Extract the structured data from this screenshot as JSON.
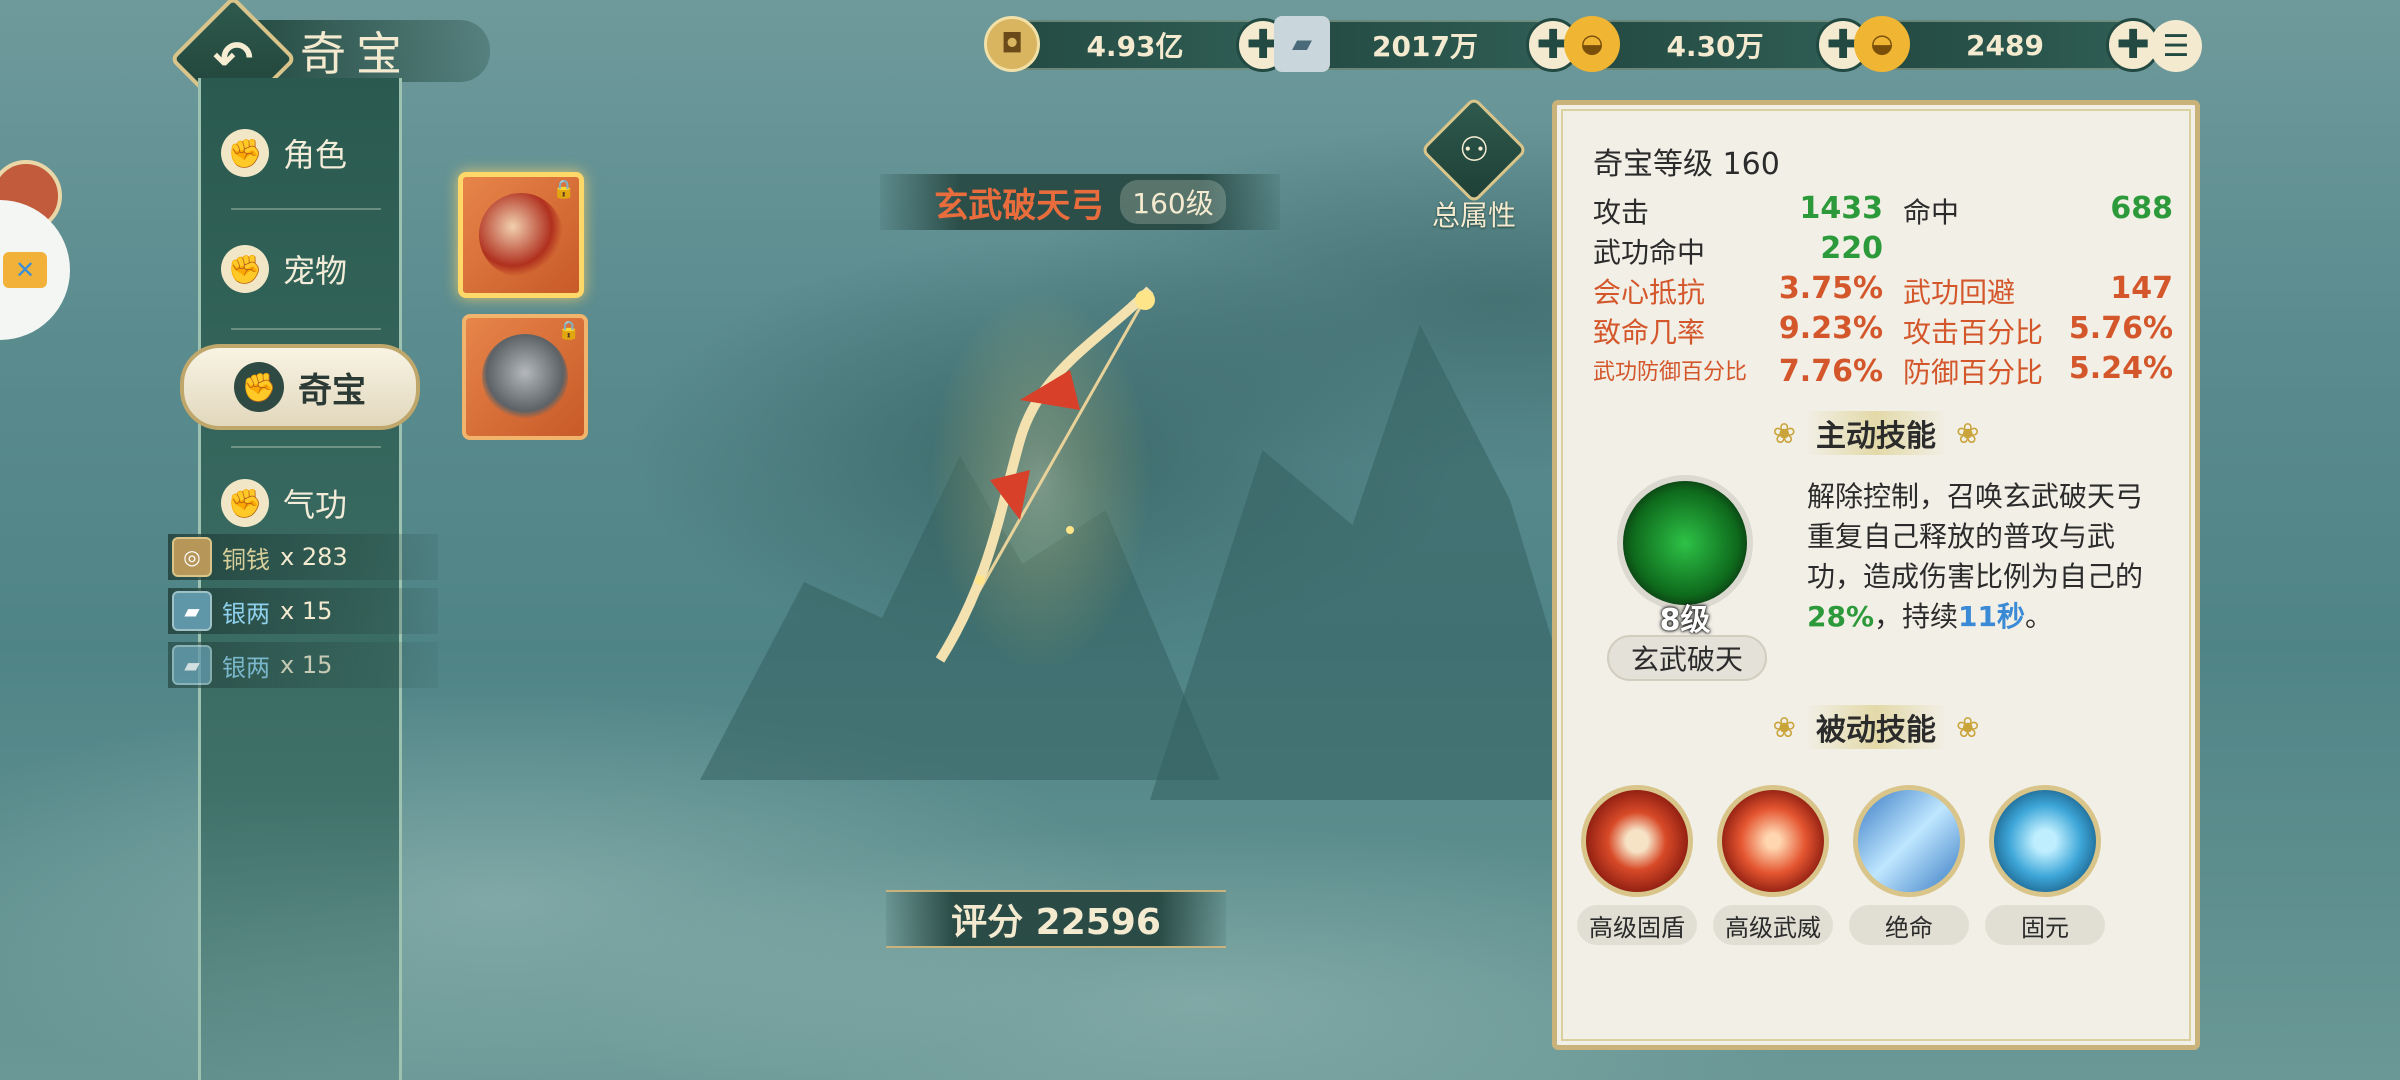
{
  "header": {
    "title": "奇宝",
    "back_icon": "back-arrow-icon"
  },
  "currencies": [
    {
      "name": "copper-coin",
      "value": "4.93亿"
    },
    {
      "name": "silver",
      "value": "2017万"
    },
    {
      "name": "gold-ingot",
      "value": "4.30万"
    },
    {
      "name": "gold-ingot-bound",
      "value": "2489"
    }
  ],
  "sidebar": {
    "items": [
      {
        "label": "角色"
      },
      {
        "label": "宠物"
      },
      {
        "label": "奇宝"
      },
      {
        "label": "气功"
      }
    ],
    "active": "奇宝"
  },
  "loot": [
    {
      "name": "铜钱",
      "count": "x 283"
    },
    {
      "name": "银两",
      "count": "x 15"
    },
    {
      "name": "银两",
      "count": "x 15"
    }
  ],
  "item": {
    "name": "玄武破天弓",
    "level": "160级",
    "score": "评分 22596"
  },
  "total_attr_label": "总属性",
  "panel": {
    "title": "奇宝等级 160",
    "stats": [
      [
        {
          "k": "攻击",
          "v": "1433"
        },
        {
          "k": "命中",
          "v": "688"
        }
      ],
      [
        {
          "k": "武功命中",
          "v": "220"
        }
      ],
      [
        {
          "k": "会心抵抗",
          "v": "3.75%"
        },
        {
          "k": "武功回避",
          "v": "147"
        }
      ],
      [
        {
          "k": "致命几率",
          "v": "9.23%"
        },
        {
          "k": "攻击百分比",
          "v": "5.76%"
        }
      ],
      [
        {
          "k": "武功防御百分比",
          "v": "7.76%"
        },
        {
          "k": "防御百分比",
          "v": "5.24%"
        }
      ]
    ],
    "active_skill": {
      "heading": "主动技能",
      "level": "8级",
      "name": "玄武破天",
      "desc_1": "解除控制，召唤玄武破天弓重复自己释放的普攻与武功，造成伤害比例为自己的",
      "desc_pct": "28%",
      "desc_2": "，持续",
      "desc_dur": "11秒",
      "desc_3": "。"
    },
    "passive_skills": {
      "heading": "被动技能",
      "items": [
        {
          "name": "高级固盾"
        },
        {
          "name": "高级武威"
        },
        {
          "name": "绝命"
        },
        {
          "name": "固元"
        }
      ]
    }
  }
}
